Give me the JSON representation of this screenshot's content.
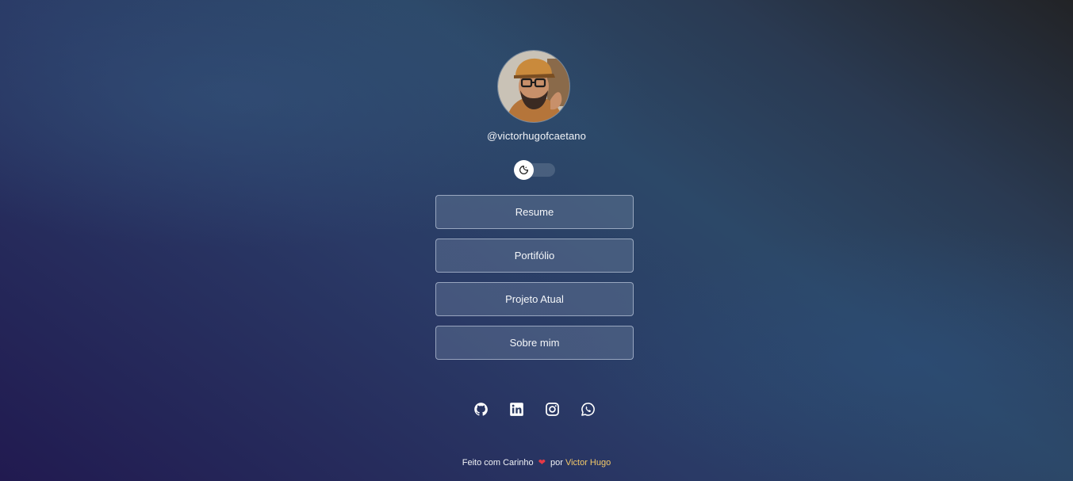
{
  "profile": {
    "username": "@victorhugofcaetano"
  },
  "theme_toggle": {
    "icon": "moon-icon"
  },
  "links": [
    {
      "label": "Resume"
    },
    {
      "label": "Portifólio"
    },
    {
      "label": "Projeto Atual"
    },
    {
      "label": "Sobre mim"
    }
  ],
  "socials": [
    {
      "icon": "github-icon"
    },
    {
      "icon": "linkedin-icon"
    },
    {
      "icon": "instagram-icon"
    },
    {
      "icon": "whatsapp-icon"
    }
  ],
  "footer": {
    "prefix": "Feito com Carinho",
    "heart": "❤",
    "middle": "por",
    "author": "Victor Hugo"
  },
  "colors": {
    "author_accent": "#f3c969",
    "heart": "#e63946"
  }
}
